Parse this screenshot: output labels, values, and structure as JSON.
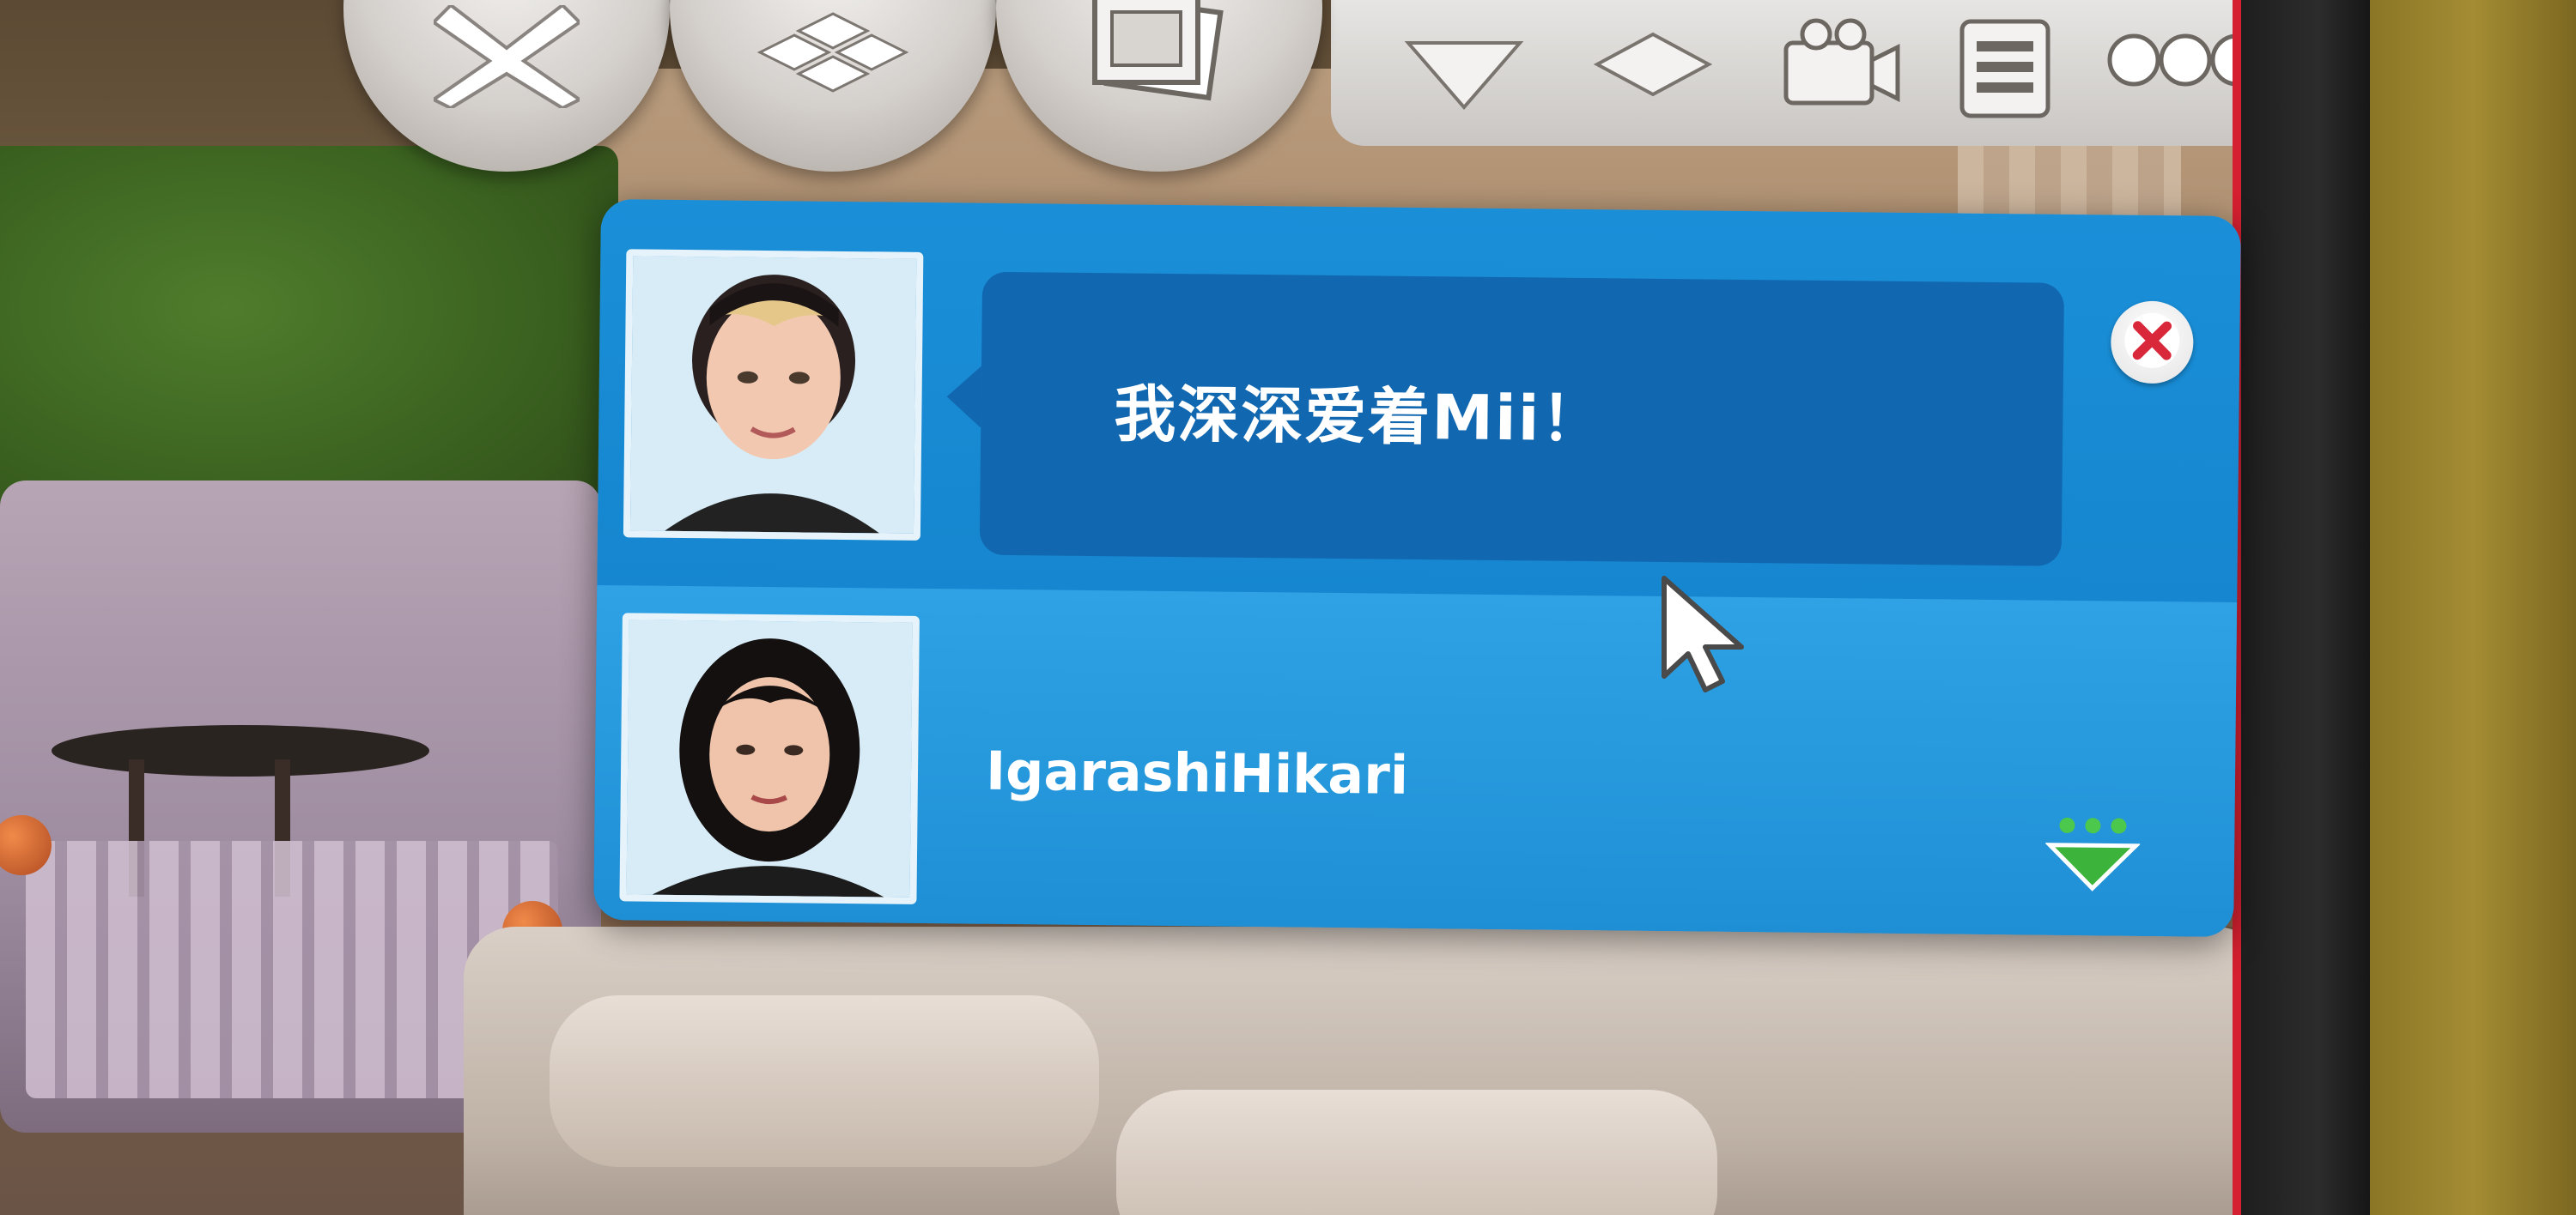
{
  "notification": {
    "message": "我深深爱着Mii！",
    "sender_name": "IgarashiHikari",
    "close_label": "Close"
  },
  "hud": {
    "buttons": [
      {
        "icon": "close-x-icon"
      },
      {
        "icon": "floor-tiles-icon"
      },
      {
        "icon": "photo-frames-icon"
      }
    ],
    "tools": [
      {
        "icon": "triangle-down-icon"
      },
      {
        "icon": "diamond-icon"
      },
      {
        "icon": "camera-icon"
      },
      {
        "icon": "list-icon"
      },
      {
        "icon": "more-options-icon"
      }
    ]
  },
  "colors": {
    "panel_blue": "#1a8fd8",
    "bubble_blue": "#1268b0",
    "close_red": "#d8283a",
    "mood_green": "#3cb43c"
  }
}
